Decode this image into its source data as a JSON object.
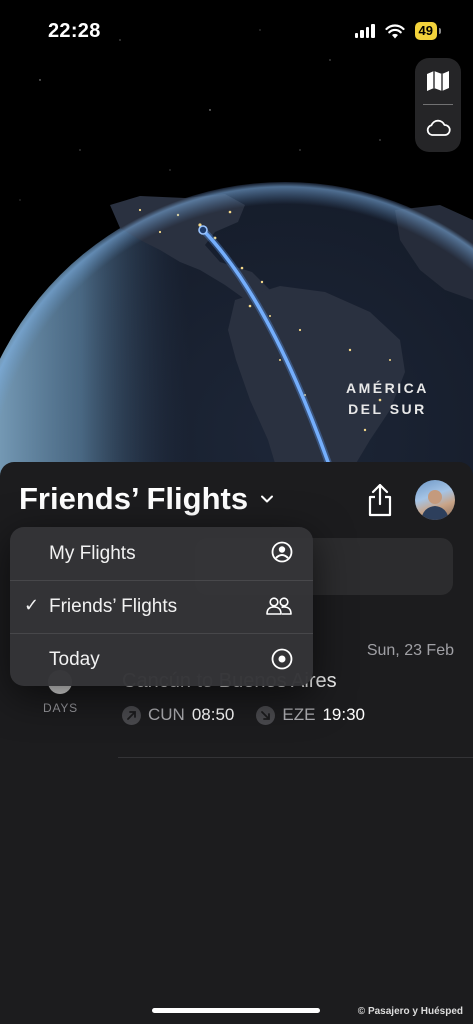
{
  "status_bar": {
    "time": "22:28",
    "battery": "49",
    "icons": [
      "signal-icon",
      "wifi-icon",
      "battery-icon"
    ]
  },
  "map": {
    "label": "AMÉRICA\nDEL SUR",
    "controls": [
      "map-icon",
      "cloud-icon"
    ],
    "flight_path_color": "#5b9cf4"
  },
  "sheet": {
    "title": "Friends’ Flights",
    "flight": {
      "date": "Sun, 23 Feb",
      "countdown_unit": "DAYS",
      "origin_city": "Cancún",
      "to_word": "to",
      "destination_city": "Buenos Aires",
      "departure": {
        "code": "CUN",
        "time": "08:50"
      },
      "arrival": {
        "code": "EZE",
        "time": "19:30"
      }
    }
  },
  "menu": {
    "items": [
      {
        "label": "My Flights",
        "icon": "person-circle-icon",
        "checked": false
      },
      {
        "label": "Friends’ Flights",
        "icon": "people-icon",
        "checked": true
      },
      {
        "label": "Today",
        "icon": "target-icon",
        "checked": false
      }
    ],
    "check_mark": "✓"
  },
  "watermark": "© Pasajero y Huésped"
}
